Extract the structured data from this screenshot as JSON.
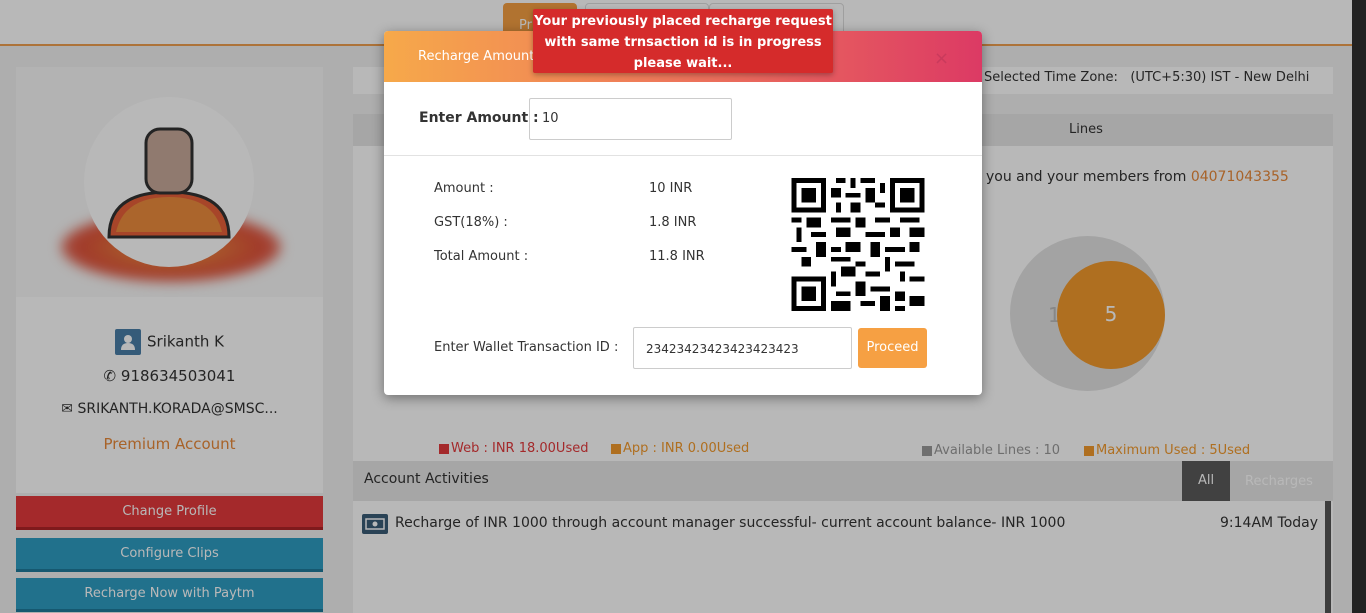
{
  "header": {
    "tab_active_label": "Pr"
  },
  "timezone": {
    "label": "Selected Time Zone:",
    "value": "(UTC+5:30) IST - New Delhi"
  },
  "profile": {
    "name": "Srikanth K",
    "phone": "918634503041",
    "email": "SRIKANTH.KORADA@SMSC...",
    "plan": "Premium Account"
  },
  "sidebar": {
    "buttons": [
      {
        "label": "Change Profile"
      },
      {
        "label": "Configure Clips"
      },
      {
        "label": "Recharge Now with Paytm"
      }
    ]
  },
  "lines_panel": {
    "header": "Lines",
    "members_text": "you and your members from",
    "members_number": "04071043355",
    "chart_data": {
      "type": "pie",
      "values": [
        10,
        5
      ],
      "labels": [
        "Available Lines",
        "Maximum Used"
      ],
      "colors": [
        "#e2e2e2",
        "#f39a2d"
      ]
    },
    "donut_left_value": "1",
    "donut_value": "5"
  },
  "legend": {
    "web": "Web : INR 18.00Used",
    "app": "App : INR 0.00Used",
    "available": "Available Lines : 10",
    "maximum": "Maximum Used : 5Used",
    "colors": {
      "web": "#e33a3c",
      "app": "#f39a2d",
      "available": "#9a9a9a",
      "maximum": "#f39a2d"
    }
  },
  "activities": {
    "title": "Account Activities",
    "tab_all": "All",
    "tab_recharges": "Recharges",
    "items": [
      {
        "text": "Recharge of INR 1000 through account manager successful- current account balance- INR 1000",
        "time": "9:14AM Today"
      }
    ]
  },
  "modal": {
    "title": "Recharge Amount",
    "close": "×",
    "amount_label": "Enter Amount :",
    "amount_value": "10",
    "rows": [
      {
        "label": "Amount :",
        "value": "10 INR"
      },
      {
        "label": "GST(18%) :",
        "value": "1.8 INR"
      },
      {
        "label": "Total Amount :",
        "value": "11.8 INR"
      }
    ],
    "txn_label": "Enter Wallet Transaction ID :",
    "txn_value": "2342342342342342342 3",
    "txn_value_exact": "23423423423423423423",
    "proceed_label": "Proceed"
  },
  "toast": {
    "line1": "Your previously placed recharge request",
    "line2": "with same trnsaction id is in progress",
    "line3": "please wait..."
  }
}
